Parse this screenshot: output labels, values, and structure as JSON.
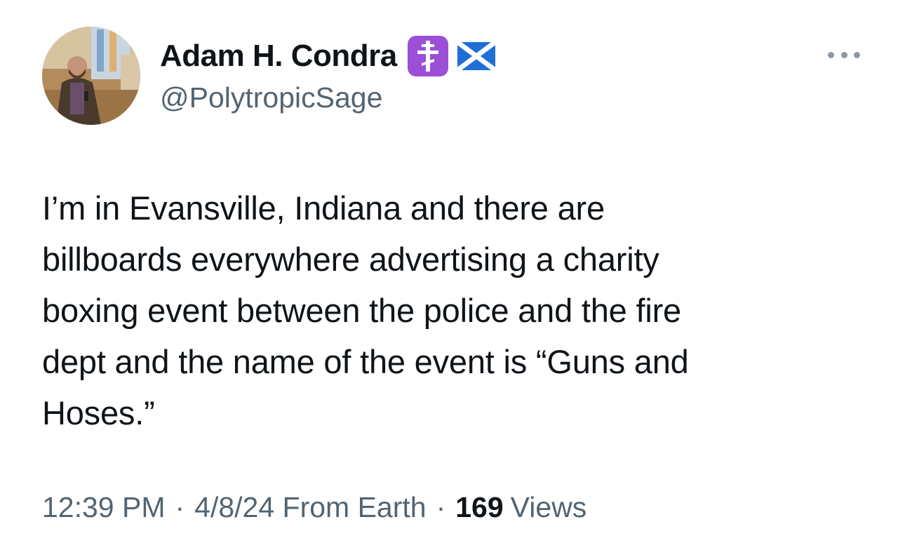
{
  "author": {
    "display_name": "Adam H. Condra",
    "handle": "@PolytropicSage",
    "badges": [
      "orthodox-cross-icon",
      "scotland-flag-icon"
    ]
  },
  "tweet": {
    "text_lines": [
      "I’m in Evansville, Indiana and there are",
      "billboards everywhere advertising a charity",
      "boxing event between the police and the fire",
      "dept and the name of the event is “Guns and",
      "Hoses.”"
    ]
  },
  "meta": {
    "time": "12:39 PM",
    "separator": "·",
    "date_source": "4/8/24 From Earth",
    "views_count": "169",
    "views_label": "Views"
  },
  "colors": {
    "text_primary": "#0f1419",
    "text_secondary": "#536471",
    "cross_badge_bg": "#9b4fd6",
    "flag_blue": "#1f6fd6"
  }
}
